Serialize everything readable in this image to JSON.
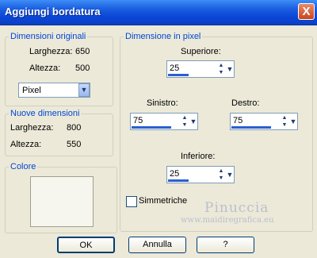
{
  "window": {
    "title": "Aggiungi bordatura",
    "close_label": "X"
  },
  "original": {
    "legend": "Dimensioni originali",
    "width_label": "Larghezza:",
    "width_value": "650",
    "height_label": "Altezza:",
    "height_value": "500",
    "unit": "Pixel"
  },
  "newdim": {
    "legend": "Nuove dimensioni",
    "width_label": "Larghezza:",
    "width_value": "800",
    "height_label": "Altezza:",
    "height_value": "550"
  },
  "color": {
    "legend": "Colore"
  },
  "pixel": {
    "legend": "Dimensione in pixel",
    "top_label": "Superiore:",
    "top_value": "25",
    "left_label": "Sinistro:",
    "left_value": "75",
    "right_label": "Destro:",
    "right_value": "75",
    "bottom_label": "Inferiore:",
    "bottom_value": "25",
    "symmetric_label": "Simmetriche",
    "symmetric_checked": false
  },
  "buttons": {
    "ok": "OK",
    "cancel": "Annulla",
    "help": "?"
  },
  "watermark": {
    "name": "Pinuccia",
    "url": "www.maidiregrafica.eu"
  }
}
